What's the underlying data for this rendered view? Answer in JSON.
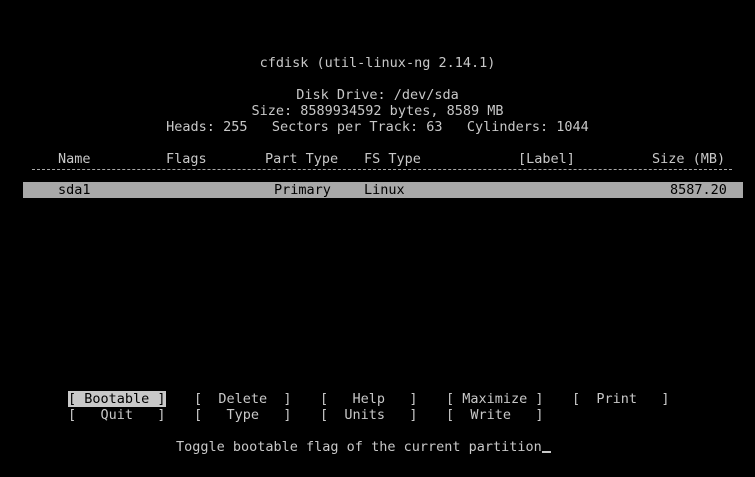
{
  "title": "cfdisk (util-linux-ng 2.14.1)",
  "disk": {
    "drive": "Disk Drive: /dev/sda",
    "size": "Size: 8589934592 bytes, 8589 MB",
    "geometry": "Heads: 255   Sectors per Track: 63   Cylinders: 1044"
  },
  "table": {
    "headers": {
      "name": "Name",
      "flags": "Flags",
      "part_type": "Part Type",
      "fs_type": "FS Type",
      "label": "[Label]",
      "size": "Size (MB)"
    },
    "rows": [
      {
        "name": "sda1",
        "flags": "",
        "part_type": "Primary",
        "fs_type": "Linux",
        "label": "",
        "size": "8587.20"
      }
    ]
  },
  "menu": {
    "bootable": "[ Bootable ]",
    "delete": "[  Delete  ]",
    "help": "[   Help   ]",
    "maximize": "[ Maximize ]",
    "print": "[  Print   ]",
    "quit": "[   Quit   ]",
    "type": "[   Type   ]",
    "units": "[  Units   ]",
    "write": "[  Write   ]"
  },
  "status": "Toggle bootable flag of the current partition"
}
